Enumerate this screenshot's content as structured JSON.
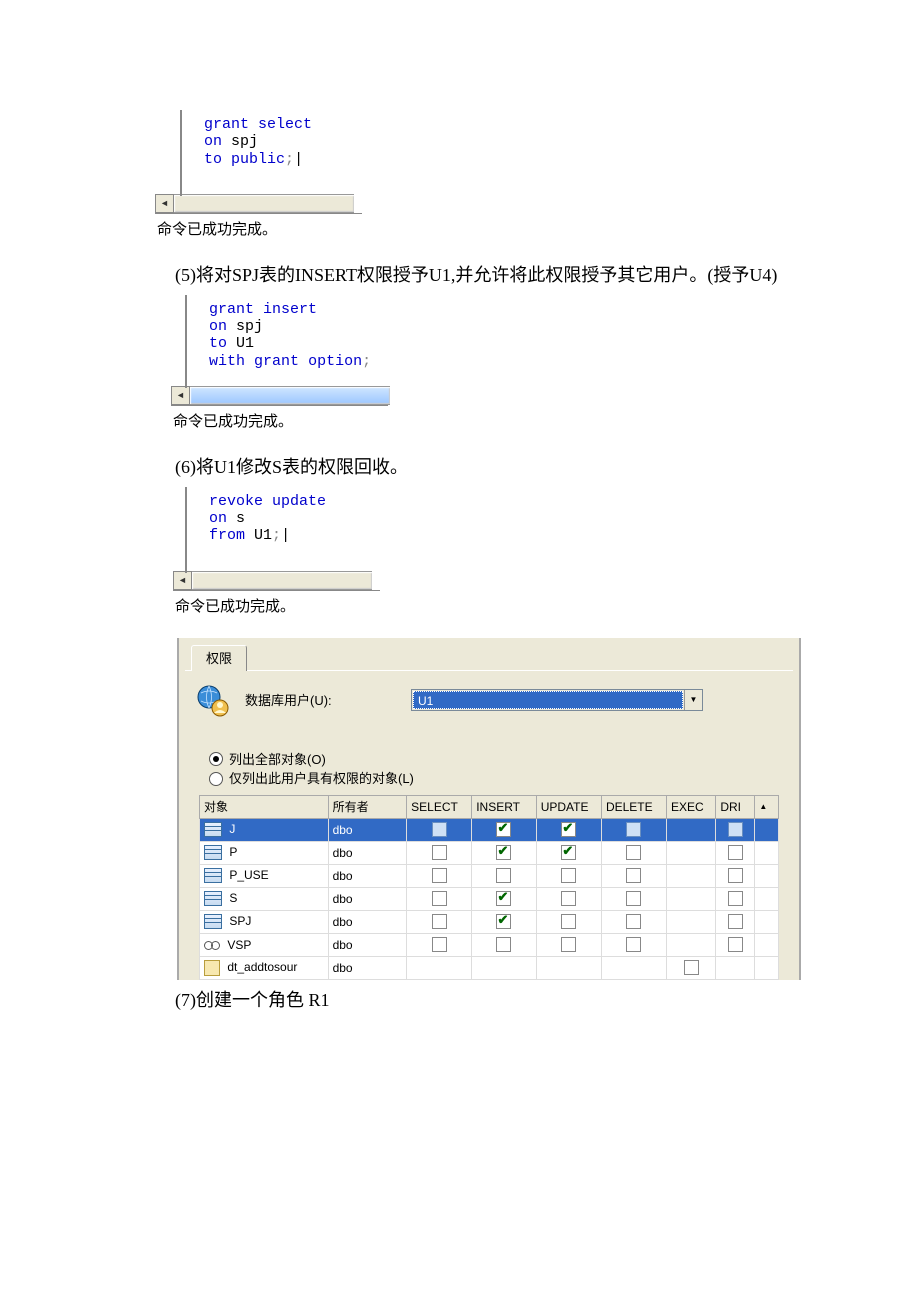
{
  "sql1": {
    "l1a": "grant",
    "l1b": "select",
    "l2a": "on",
    "l2b": "spj",
    "l3a": "to",
    "l3b": "public",
    "l3c": ";"
  },
  "status1": "命令已成功完成。",
  "instr5": "(5)将对SPJ表的INSERT权限授予U1,并允许将此权限授予其它用户。(授予U4)",
  "sql2": {
    "l1a": "grant",
    "l1b": "insert",
    "l2a": "on",
    "l2b": "spj",
    "l3a": "to",
    "l3b": "U1",
    "l4a": "with",
    "l4b": "grant",
    "l4c": "option",
    "l4d": ";"
  },
  "status2": "命令已成功完成。",
  "instr6": "(6)将U1修改S表的权限回收。",
  "sql3": {
    "l1a": "revoke",
    "l1b": "update",
    "l2a": "on",
    "l2b": "s",
    "l3a": "from",
    "l3b": "U1",
    "l3c": ";"
  },
  "status3": "命令已成功完成。",
  "perm": {
    "tab": "权限",
    "user_label": "数据库用户(U):",
    "user_value": "U1",
    "radio1": "列出全部对象(O)",
    "radio2": "仅列出此用户具有权限的对象(L)",
    "cols": {
      "obj": "对象",
      "owner": "所有者",
      "select": "SELECT",
      "insert": "INSERT",
      "update": "UPDATE",
      "delete": "DELETE",
      "exec": "EXEC",
      "dri": "DRI"
    },
    "rows": [
      {
        "name": "J",
        "owner": "dbo",
        "type": "table",
        "sel": true,
        "select": "box-sel",
        "insert": "chk",
        "update": "chk",
        "delete": "box-sel",
        "exec": "",
        "dri": "box-sel"
      },
      {
        "name": "P",
        "owner": "dbo",
        "type": "table",
        "sel": false,
        "select": "box",
        "insert": "chk",
        "update": "chk",
        "delete": "box",
        "exec": "",
        "dri": "box"
      },
      {
        "name": "P_USE",
        "owner": "dbo",
        "type": "table",
        "sel": false,
        "select": "box",
        "insert": "box",
        "update": "box",
        "delete": "box",
        "exec": "",
        "dri": "box"
      },
      {
        "name": "S",
        "owner": "dbo",
        "type": "table",
        "sel": false,
        "select": "box",
        "insert": "chk",
        "update": "box",
        "delete": "box",
        "exec": "",
        "dri": "box"
      },
      {
        "name": "SPJ",
        "owner": "dbo",
        "type": "table",
        "sel": false,
        "select": "box",
        "insert": "chk",
        "update": "box",
        "delete": "box",
        "exec": "",
        "dri": "box"
      },
      {
        "name": "VSP",
        "owner": "dbo",
        "type": "view",
        "sel": false,
        "select": "box",
        "insert": "box",
        "update": "box",
        "delete": "box",
        "exec": "",
        "dri": "box"
      },
      {
        "name": "dt_addtosour",
        "owner": "dbo",
        "type": "proc",
        "sel": false,
        "select": "",
        "insert": "",
        "update": "",
        "delete": "",
        "exec": "box",
        "dri": ""
      }
    ]
  },
  "instr7": "(7)创建一个角色 R1"
}
